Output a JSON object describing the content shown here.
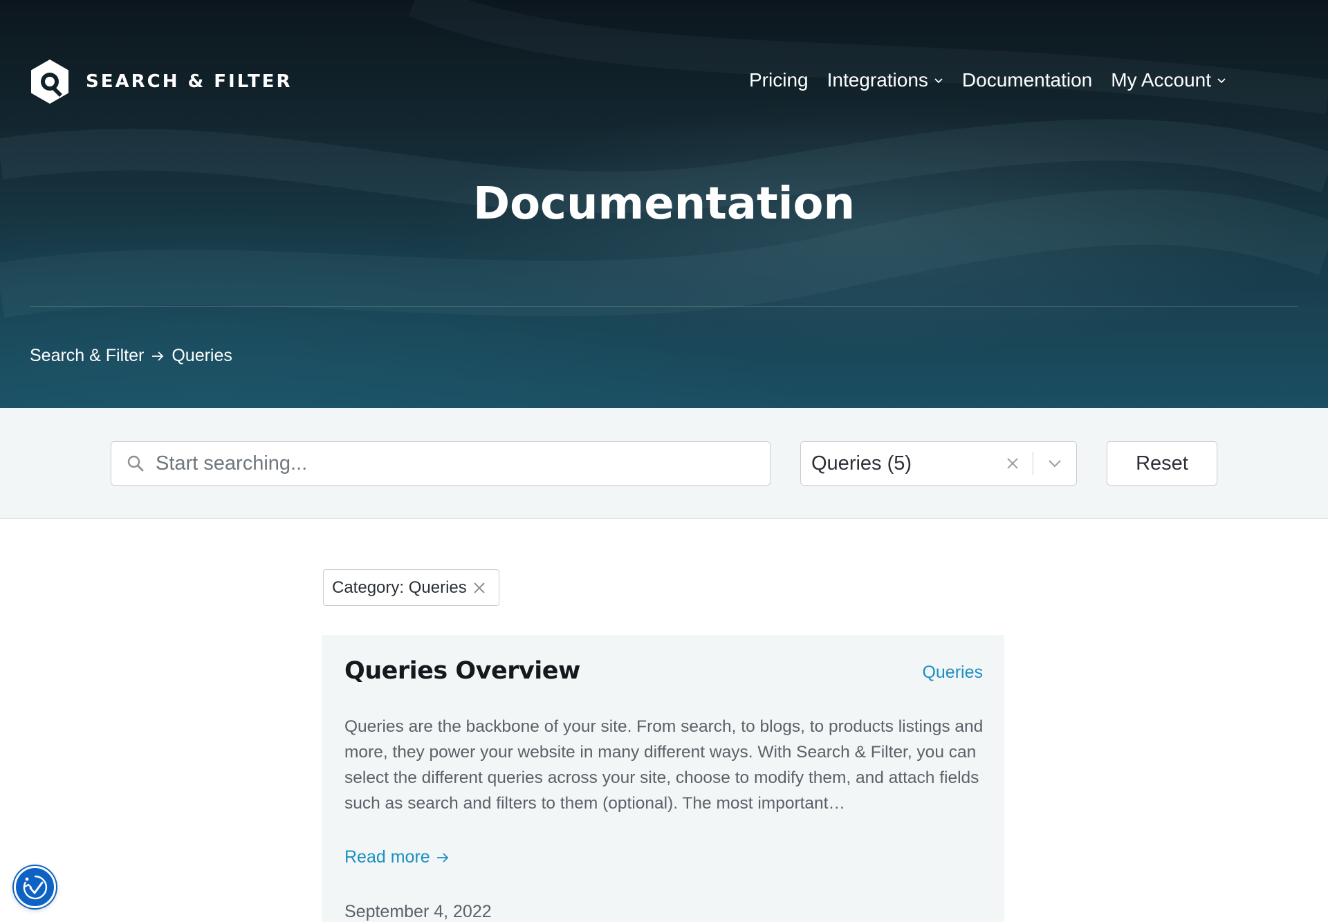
{
  "brand": {
    "name": "SEARCH & FILTER"
  },
  "nav": {
    "items": [
      {
        "label": "Pricing",
        "has_dropdown": false
      },
      {
        "label": "Integrations",
        "has_dropdown": true
      },
      {
        "label": "Documentation",
        "has_dropdown": false
      },
      {
        "label": "My Account",
        "has_dropdown": true
      }
    ]
  },
  "hero": {
    "title": "Documentation"
  },
  "breadcrumb": {
    "items": [
      "Search & Filter",
      "Queries"
    ]
  },
  "filters": {
    "search_placeholder": "Start searching...",
    "search_value": "",
    "category_select_value": "Queries  (5)",
    "reset_label": "Reset"
  },
  "active_filter_chip": {
    "label": "Category: Queries"
  },
  "results": [
    {
      "title": "Queries Overview",
      "category": "Queries",
      "excerpt": "Queries are the backbone of your site. From search, to blogs, to products listings and more, they power your website in many different ways. With Search & Filter, you can select the different queries across your site, choose to modify them, and attach fields such as search and filters to them (optional). The most important…",
      "read_more": "Read more",
      "date": "September 4, 2022"
    }
  ],
  "colors": {
    "link_accent": "#1c8fc2",
    "filter_band_bg": "#f3f6f7",
    "hero_dark": "#0c161d",
    "hero_teal": "#1b4f63",
    "accessibility_button": "#0d62c4"
  }
}
